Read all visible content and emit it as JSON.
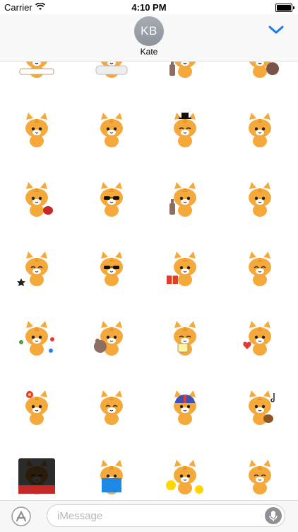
{
  "status_bar": {
    "carrier": "Carrier",
    "time": "4:10 PM"
  },
  "header": {
    "avatar_initials": "KB",
    "contact_name": "Kate"
  },
  "message_bar": {
    "placeholder": "iMessage"
  },
  "colors": {
    "cat_orange": "#F6A93B",
    "cat_stripe": "#E88A1A",
    "accent_blue": "#1E7CF2"
  },
  "stickers": [
    {
      "id": "sleeping-1",
      "icon": "sleeping-cat-icon"
    },
    {
      "id": "bath",
      "icon": "bath-cat-icon"
    },
    {
      "id": "bottle",
      "icon": "bottle-cat-icon"
    },
    {
      "id": "barrel",
      "icon": "barrel-cat-icon"
    },
    {
      "id": "angry-1",
      "icon": "cat-icon"
    },
    {
      "id": "sick-1",
      "icon": "cat-icon"
    },
    {
      "id": "hat-1",
      "icon": "top-hat-cat-icon"
    },
    {
      "id": "talk-1",
      "icon": "cat-icon"
    },
    {
      "id": "guitar-1",
      "icon": "guitar-cat-icon"
    },
    {
      "id": "sunglasses-car",
      "icon": "sunglasses-cat-icon"
    },
    {
      "id": "bottle-cat",
      "icon": "bottle-cat-icon"
    },
    {
      "id": "sleepy-head",
      "icon": "cat-icon"
    },
    {
      "id": "star",
      "icon": "star-cat-icon"
    },
    {
      "id": "cool-suit",
      "icon": "sunglasses-cat-icon"
    },
    {
      "id": "gift",
      "icon": "gift-cat-icon"
    },
    {
      "id": "purple-scarf",
      "icon": "cat-icon"
    },
    {
      "id": "confetti",
      "icon": "party-cat-icon"
    },
    {
      "id": "teddy",
      "icon": "teddy-cat-icon"
    },
    {
      "id": "tea",
      "icon": "tea-cat-icon"
    },
    {
      "id": "heart",
      "icon": "heart-cat-icon"
    },
    {
      "id": "flower",
      "icon": "flower-cat-icon"
    },
    {
      "id": "tears",
      "icon": "cat-icon"
    },
    {
      "id": "helmet",
      "icon": "helmet-cat-icon"
    },
    {
      "id": "music",
      "icon": "music-cat-icon"
    },
    {
      "id": "theater",
      "icon": "theater-cat-icon"
    },
    {
      "id": "book",
      "icon": "book-cat-icon"
    },
    {
      "id": "emoji",
      "icon": "emoji-cat-icon"
    },
    {
      "id": "sad",
      "icon": "cat-icon"
    }
  ]
}
